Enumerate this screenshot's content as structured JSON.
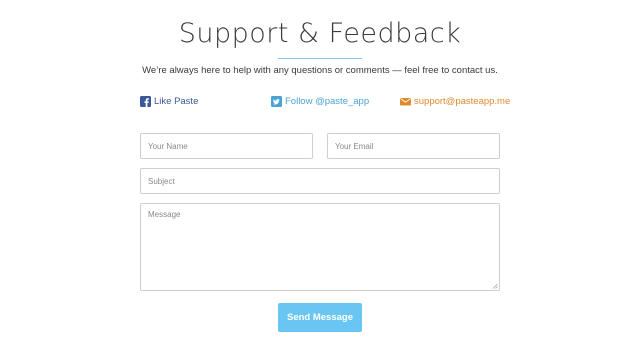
{
  "page": {
    "title": "Support & Feedback",
    "subtitle": "We’re always here to help with any questions or comments — feel free to contact us."
  },
  "contact_links": {
    "facebook": {
      "label": "Like Paste",
      "icon": "facebook-icon",
      "color": "#3b5998"
    },
    "twitter": {
      "label": "Follow @paste_app",
      "icon": "twitter-icon",
      "color": "#4aa3d3"
    },
    "email": {
      "label": "support@pasteapp.me",
      "icon": "mail-icon",
      "color": "#e08a2c"
    }
  },
  "form": {
    "name_placeholder": "Your Name",
    "email_placeholder": "Your Email",
    "subject_placeholder": "Subject",
    "message_placeholder": "Message",
    "submit_label": "Send Message"
  },
  "colors": {
    "accent": "#69c5f2",
    "underline": "#7fcbe8"
  }
}
